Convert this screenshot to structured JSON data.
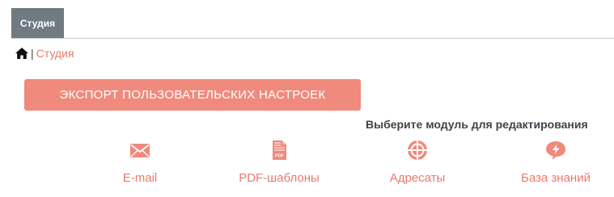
{
  "tabs": [
    {
      "label": "Студия",
      "active": true
    }
  ],
  "breadcrumb": {
    "home_icon": "home-icon",
    "separator": "|",
    "current": "Студия"
  },
  "export_button": {
    "label": "ЭКСПОРТ ПОЛЬЗОВАТЕЛЬСКИХ НАСТРОЕК"
  },
  "modules_heading": "Выберите модуль для редактирования",
  "modules": [
    {
      "label": "E-mail",
      "icon": "envelope-icon"
    },
    {
      "label": "PDF-шаблоны",
      "icon": "pdf-file-icon"
    },
    {
      "label": "Адресаты",
      "icon": "crosshair-icon"
    },
    {
      "label": "База знаний",
      "icon": "lightning-bubble-icon"
    }
  ],
  "colors": {
    "accent": "#ef8a7c",
    "link": "#e97a6d",
    "tab_bg": "#6f7a81",
    "heading": "#3f434a"
  }
}
